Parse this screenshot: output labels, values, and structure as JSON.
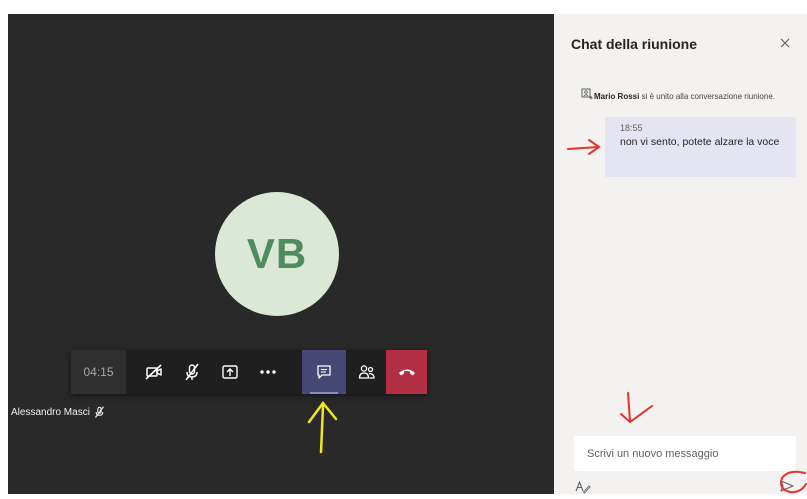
{
  "meeting": {
    "avatar_initials": "VB",
    "timer": "04:15",
    "participant_name": "Alessandro Masci",
    "toolbar": {
      "camera_icon": "camera-off-icon",
      "mic_icon": "mic-off-icon",
      "share_icon": "share-screen-icon",
      "more_icon": "more-dots-icon",
      "chat_icon": "chat-icon",
      "participants_icon": "participants-icon",
      "hangup_icon": "phone-hangup-icon",
      "active_button": "chat",
      "hangup_color": "#b22f43"
    }
  },
  "chat_panel": {
    "title": "Chat della riunione",
    "close_icon": "close-icon",
    "system_message": {
      "icon": "participant-join-icon",
      "name": "Mario Rossi",
      "text": "si è unito alla conversazione riunione."
    },
    "message": {
      "time": "18:55",
      "text": "non vi sento, potete alzare la voce"
    },
    "compose": {
      "placeholder": "Scrivi un nuovo messaggio",
      "format_icon": "format-text-icon",
      "send_icon": "send-icon"
    }
  },
  "colors": {
    "stage": "#292929",
    "panel": "#f3f2f1",
    "bubble": "#e5e5f1",
    "accent": "#464775",
    "annotation_red": "#e8322b",
    "annotation_yellow": "#f4e51a"
  }
}
